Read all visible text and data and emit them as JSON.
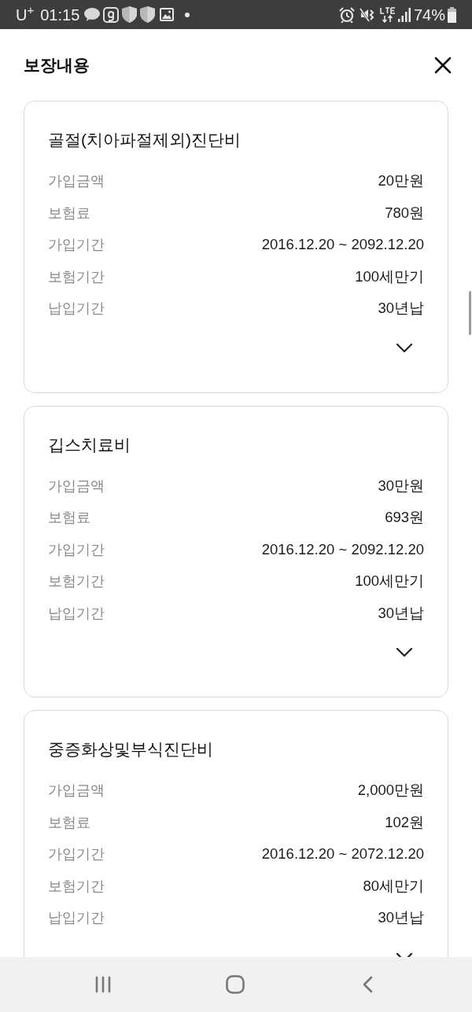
{
  "status_bar": {
    "carrier": "U$^{+}$",
    "time": "01:15",
    "battery": "74%"
  },
  "header": {
    "title": "보장내용"
  },
  "cards": [
    {
      "title": "골절(치아파절제외)진단비",
      "expanded": false,
      "rows": [
        {
          "label": "가입금액",
          "value": "20만원"
        },
        {
          "label": "보험료",
          "value": "780원"
        },
        {
          "label": "가입기간",
          "value": "2016.12.20 ~ 2092.12.20"
        },
        {
          "label": "보험기간",
          "value": "100세만기"
        },
        {
          "label": "납입기간",
          "value": "30년납"
        }
      ]
    },
    {
      "title": "깁스치료비",
      "expanded": false,
      "rows": [
        {
          "label": "가입금액",
          "value": "30만원"
        },
        {
          "label": "보험료",
          "value": "693원"
        },
        {
          "label": "가입기간",
          "value": "2016.12.20 ~ 2092.12.20"
        },
        {
          "label": "보험기간",
          "value": "100세만기"
        },
        {
          "label": "납입기간",
          "value": "30년납"
        }
      ]
    },
    {
      "title": "중증화상및부식진단비",
      "expanded": false,
      "rows": [
        {
          "label": "가입금액",
          "value": "2,000만원"
        },
        {
          "label": "보험료",
          "value": "102원"
        },
        {
          "label": "가입기간",
          "value": "2016.12.20 ~ 2072.12.20"
        },
        {
          "label": "보험기간",
          "value": "80세만기"
        },
        {
          "label": "납입기간",
          "value": "30년납"
        }
      ]
    }
  ]
}
